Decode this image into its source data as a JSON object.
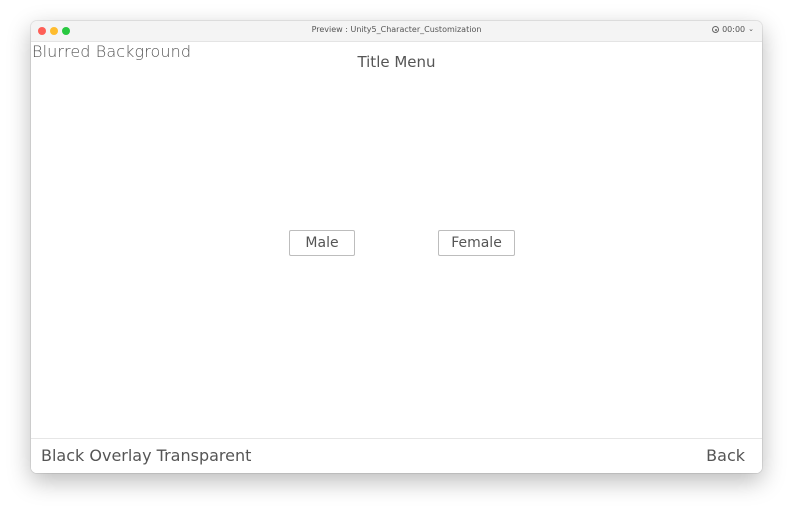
{
  "window": {
    "title": "Preview : Unity5_Character_Customization",
    "timer": "00:00",
    "icons": [
      "close-icon",
      "minimize-icon",
      "maximize-icon",
      "record-icon",
      "chevron-down-icon"
    ]
  },
  "content": {
    "top_left_label": "Blurred Background",
    "menu_title": "Title Menu",
    "buttons": {
      "male": "Male",
      "female": "Female"
    }
  },
  "bottom": {
    "left_label": "Black Overlay Transparent",
    "back_label": "Back"
  },
  "colors": {
    "text": "#555555",
    "button_border": "#bdbdbd",
    "close": "#fe5f57",
    "minimize": "#febc2e",
    "maximize": "#28c840"
  }
}
